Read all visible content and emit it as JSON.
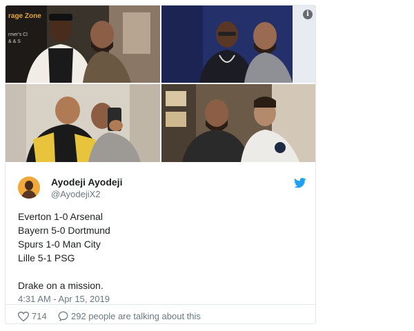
{
  "tweet": {
    "author": {
      "name": "Ayodeji Ayodeji",
      "handle": "@AyodejiX2"
    },
    "lines": [
      "Everton 1-0 Arsenal",
      "Bayern 5-0 Dortmund",
      "Spurs 1-0 Man City",
      "Lille 5-1 PSG",
      "",
      "Drake on a mission."
    ],
    "timestamp": "4:31 AM - Apr 15, 2019",
    "likes": "714",
    "conversation": "292 people are talking about this"
  },
  "photo_text": {
    "sign_line_1": "rage Zone",
    "sign_line_2": "rmer's Cl",
    "sign_line_3": "& & S"
  },
  "icons": {
    "info": "info-icon",
    "twitter": "twitter-bird-icon",
    "like": "heart-icon",
    "reply": "speech-bubble-icon"
  },
  "colors": {
    "twitter_blue": "#1da1f2",
    "muted_text": "#697882",
    "border": "#e1e8ed"
  }
}
